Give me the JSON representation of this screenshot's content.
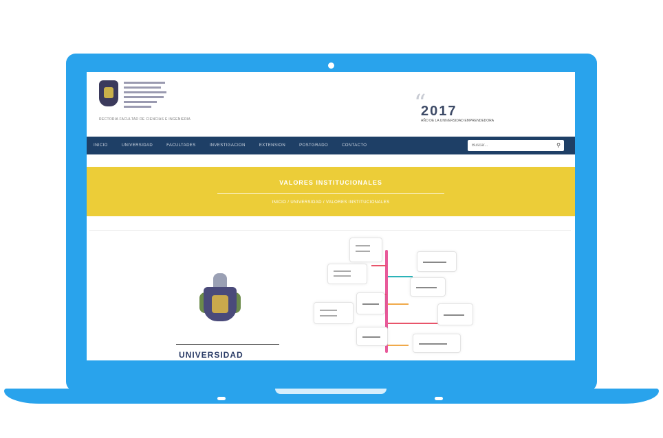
{
  "site": {
    "university_name": "RECTORIA FACULTAD DE CIENCIAS E INGENIERIA",
    "year": "2017",
    "year_caption": "AÑO DE LA UNIVERSIDAD EMPRENDEDORA"
  },
  "nav": {
    "items": [
      "INICIO",
      "UNIVERSIDAD",
      "FACULTADES",
      "INVESTIGACION",
      "EXTENSION",
      "POSTGRADO",
      "CONTACTO"
    ],
    "search_placeholder": "Buscar..."
  },
  "banner": {
    "title": "VALORES INSTITUCIONALES",
    "breadcrumb": "INICIO / UNIVERSIDAD / VALORES INSTITUCIONALES"
  },
  "content": {
    "motto": "UNIVERSIDAD"
  },
  "colors": {
    "frame": "#29a3ec",
    "nav": "#1e3f66",
    "banner": "#eccd38"
  }
}
